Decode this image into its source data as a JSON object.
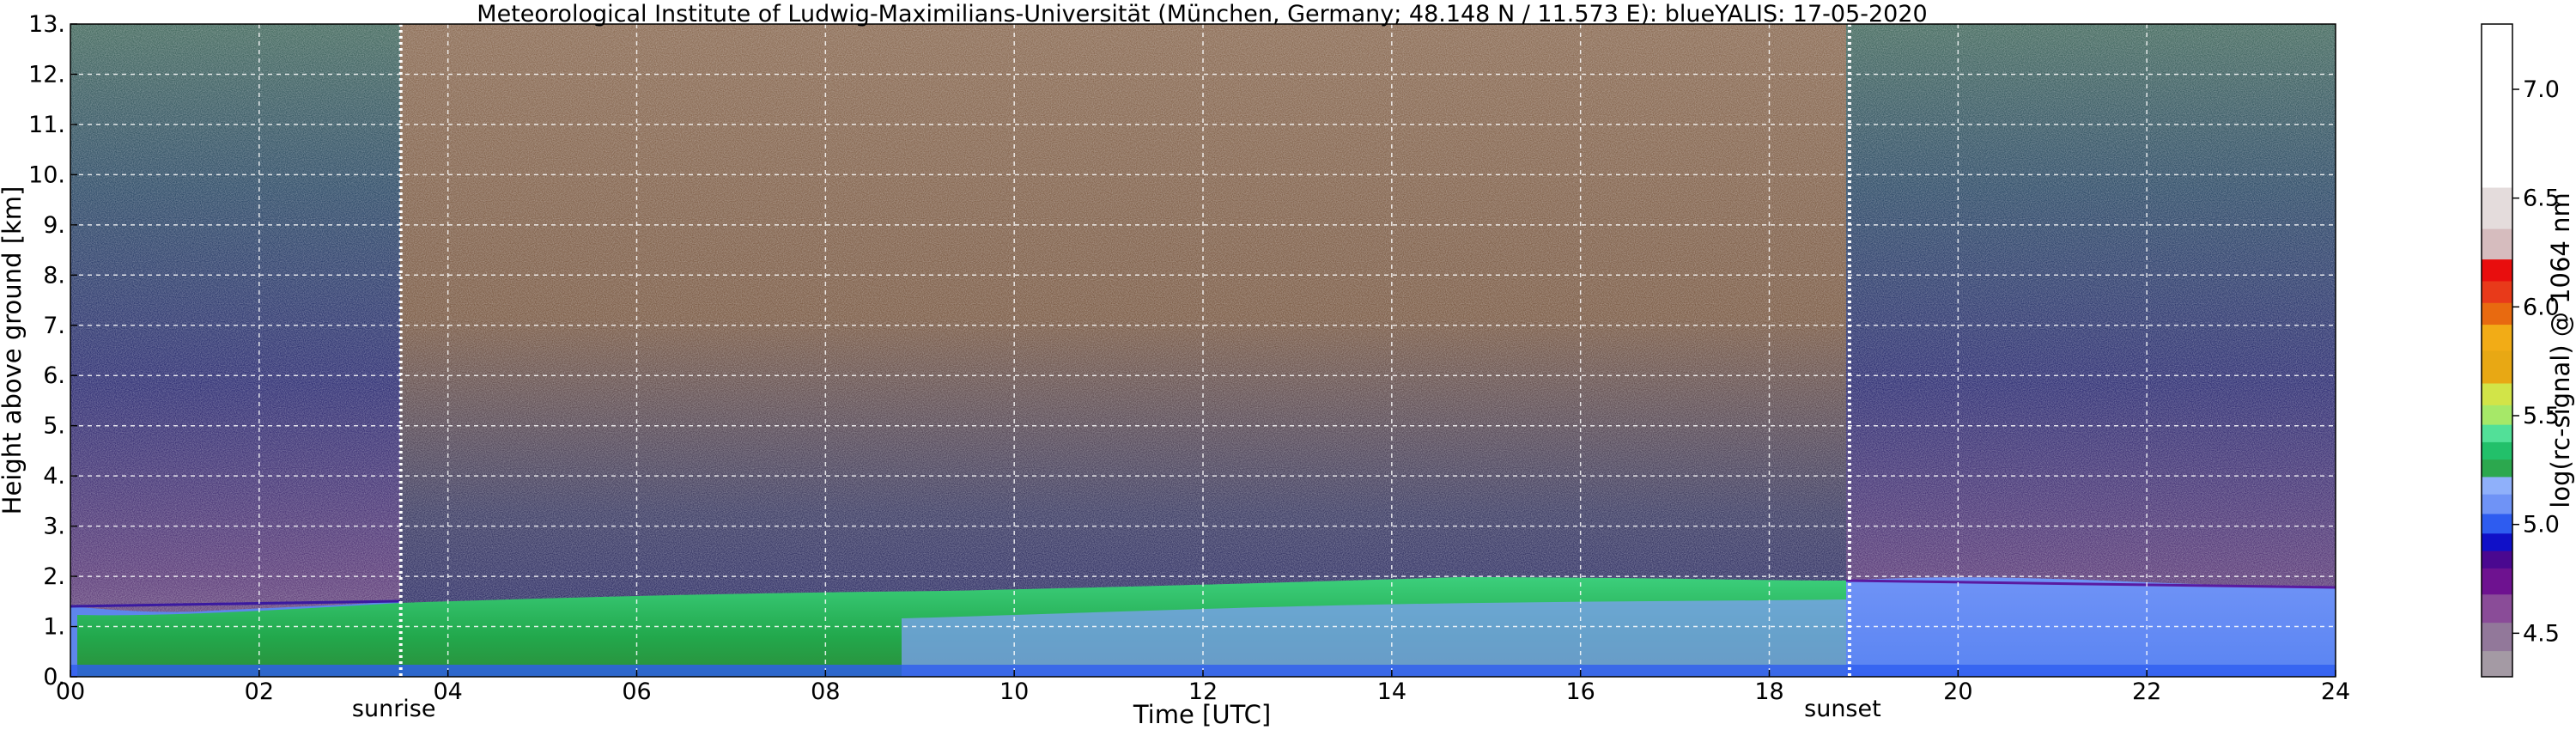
{
  "chart_data": {
    "type": "heatmap",
    "title": "Meteorological Institute of Ludwig-Maximilians-Universität (München, Germany; 48.148 N / 11.573 E):    blueYALIS: 17-05-2020",
    "xlabel": "Time [UTC]",
    "ylabel": "Height above ground [km]",
    "colorbar_label": "log(rc-signal) @ 1064 nm",
    "xlim": [
      0,
      24
    ],
    "ylim": [
      0,
      13
    ],
    "x_ticks": [
      "00",
      "02",
      "04",
      "06",
      "08",
      "10",
      "12",
      "14",
      "16",
      "18",
      "20",
      "22",
      "24"
    ],
    "y_ticks": [
      "0.",
      "1.",
      "2.",
      "3.",
      "4.",
      "5.",
      "6.",
      "7.",
      "8.",
      "9.",
      "10.",
      "11.",
      "12.",
      "13."
    ],
    "colorbar_ticks": [
      "4.5",
      "5.0",
      "5.5",
      "6.0",
      "6.5",
      "7.0"
    ],
    "colorbar_range": [
      4.3,
      7.3
    ],
    "grid": true,
    "annotations": [
      {
        "label": "sunrise",
        "time": 3.5
      },
      {
        "label": "sunset",
        "time": 18.85
      }
    ],
    "colormap": [
      {
        "v": 4.3,
        "color": "#a49aa4"
      },
      {
        "v": 4.42,
        "color": "#92789a"
      },
      {
        "v": 4.55,
        "color": "#8a4c98"
      },
      {
        "v": 4.68,
        "color": "#6e1290"
      },
      {
        "v": 4.8,
        "color": "#4a0890"
      },
      {
        "v": 4.88,
        "color": "#1010c8"
      },
      {
        "v": 4.96,
        "color": "#2e5cf0"
      },
      {
        "v": 5.05,
        "color": "#6f93f6"
      },
      {
        "v": 5.14,
        "color": "#8fb0fa"
      },
      {
        "v": 5.22,
        "color": "#2ca84e"
      },
      {
        "v": 5.3,
        "color": "#22c06a"
      },
      {
        "v": 5.38,
        "color": "#52e098"
      },
      {
        "v": 5.46,
        "color": "#a6e868"
      },
      {
        "v": 5.55,
        "color": "#d2e448"
      },
      {
        "v": 5.65,
        "color": "#e8a814"
      },
      {
        "v": 5.8,
        "color": "#f2ac16"
      },
      {
        "v": 5.92,
        "color": "#e86a10"
      },
      {
        "v": 6.02,
        "color": "#e83a1a"
      },
      {
        "v": 6.12,
        "color": "#e80e0e"
      },
      {
        "v": 6.22,
        "color": "#d6bcbe"
      },
      {
        "v": 6.36,
        "color": "#e4dcdc"
      },
      {
        "v": 6.55,
        "color": "#ffffff"
      },
      {
        "v": 7.3,
        "color": "#ffffff"
      }
    ]
  }
}
